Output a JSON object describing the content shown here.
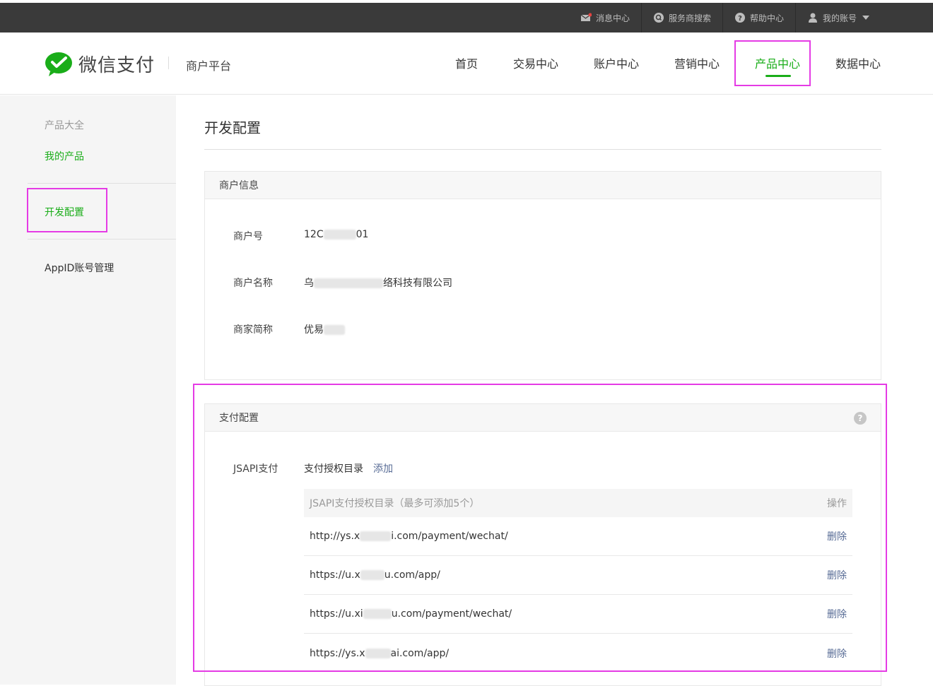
{
  "topbar": {
    "items": [
      {
        "label": "消息中心",
        "icon": "mail-icon"
      },
      {
        "label": "服务商搜索",
        "icon": "search-icon"
      },
      {
        "label": "帮助中心",
        "icon": "help-icon"
      },
      {
        "label": "我的账号",
        "icon": "user-icon"
      }
    ]
  },
  "header": {
    "logo_text": "微信支付",
    "platform": "商户平台",
    "nav": [
      "首页",
      "交易中心",
      "账户中心",
      "营销中心",
      "产品中心",
      "数据中心"
    ],
    "active_nav": "产品中心",
    "brand_color": "#1aad19"
  },
  "sidebar": {
    "items": [
      "产品大全",
      "我的产品",
      "开发配置",
      "AppID账号管理"
    ]
  },
  "main": {
    "title": "开发配置",
    "merchant_panel": {
      "title": "商户信息",
      "fields": [
        {
          "label": "商户号",
          "value_prefix": "12C",
          "value_suffix": "01"
        },
        {
          "label": "商户名称",
          "value_prefix": "乌",
          "value_suffix": "络科技有限公司"
        },
        {
          "label": "商家简称",
          "value_prefix": "优易",
          "value_suffix": ""
        }
      ]
    },
    "pay_panel": {
      "title": "支付配置",
      "jsapi_label": "JSAPI支付",
      "dir_label": "支付授权目录",
      "add_link": "添加",
      "table_header": "JSAPI支付授权目录（最多可添加5个）",
      "table_action_header": "操作",
      "rows": [
        {
          "prefix": "http://ys.x",
          "suffix": "i.com/payment/wechat/",
          "action": "删除"
        },
        {
          "prefix": "https://u.x",
          "suffix": "u.com/app/",
          "action": "删除"
        },
        {
          "prefix": "https://u.xi",
          "suffix": "u.com/payment/wechat/",
          "action": "删除"
        },
        {
          "prefix": "https://ys.x",
          "suffix": "ai.com/app/",
          "action": "删除"
        }
      ]
    }
  }
}
